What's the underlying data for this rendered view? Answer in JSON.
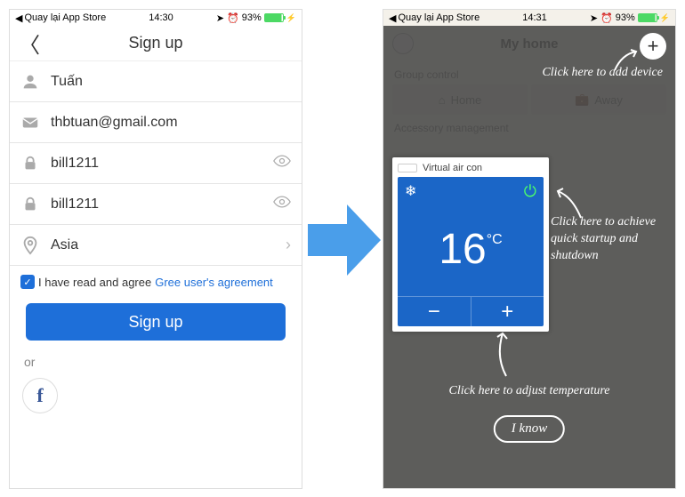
{
  "left": {
    "status": {
      "back_app": "Quay lại App Store",
      "time": "14:30",
      "battery": "93%"
    },
    "nav_title": "Sign up",
    "fields": {
      "name": "Tuấn",
      "email": "thbtuan@gmail.com",
      "password": "bill1211",
      "password_confirm": "bill1211",
      "region": "Asia"
    },
    "agree_text": "I have read and agree",
    "agree_link": "Gree user's agreement",
    "signup_button": "Sign up",
    "or": "or"
  },
  "right": {
    "status": {
      "back_app": "Quay lại App Store",
      "time": "14:31",
      "battery": "93%"
    },
    "nav_title": "My home",
    "group_label": "Group control",
    "seg_home": "Home",
    "seg_away": "Away",
    "acc_label": "Accessory management",
    "device_name": "Virtual air con",
    "temperature": "16",
    "temp_unit": "°C",
    "tip_add": "Click here to add device",
    "tip_power": "Click here to achieve quick startup and shutdown",
    "tip_temp": "Click here to adjust temperature",
    "i_know": "I know"
  }
}
